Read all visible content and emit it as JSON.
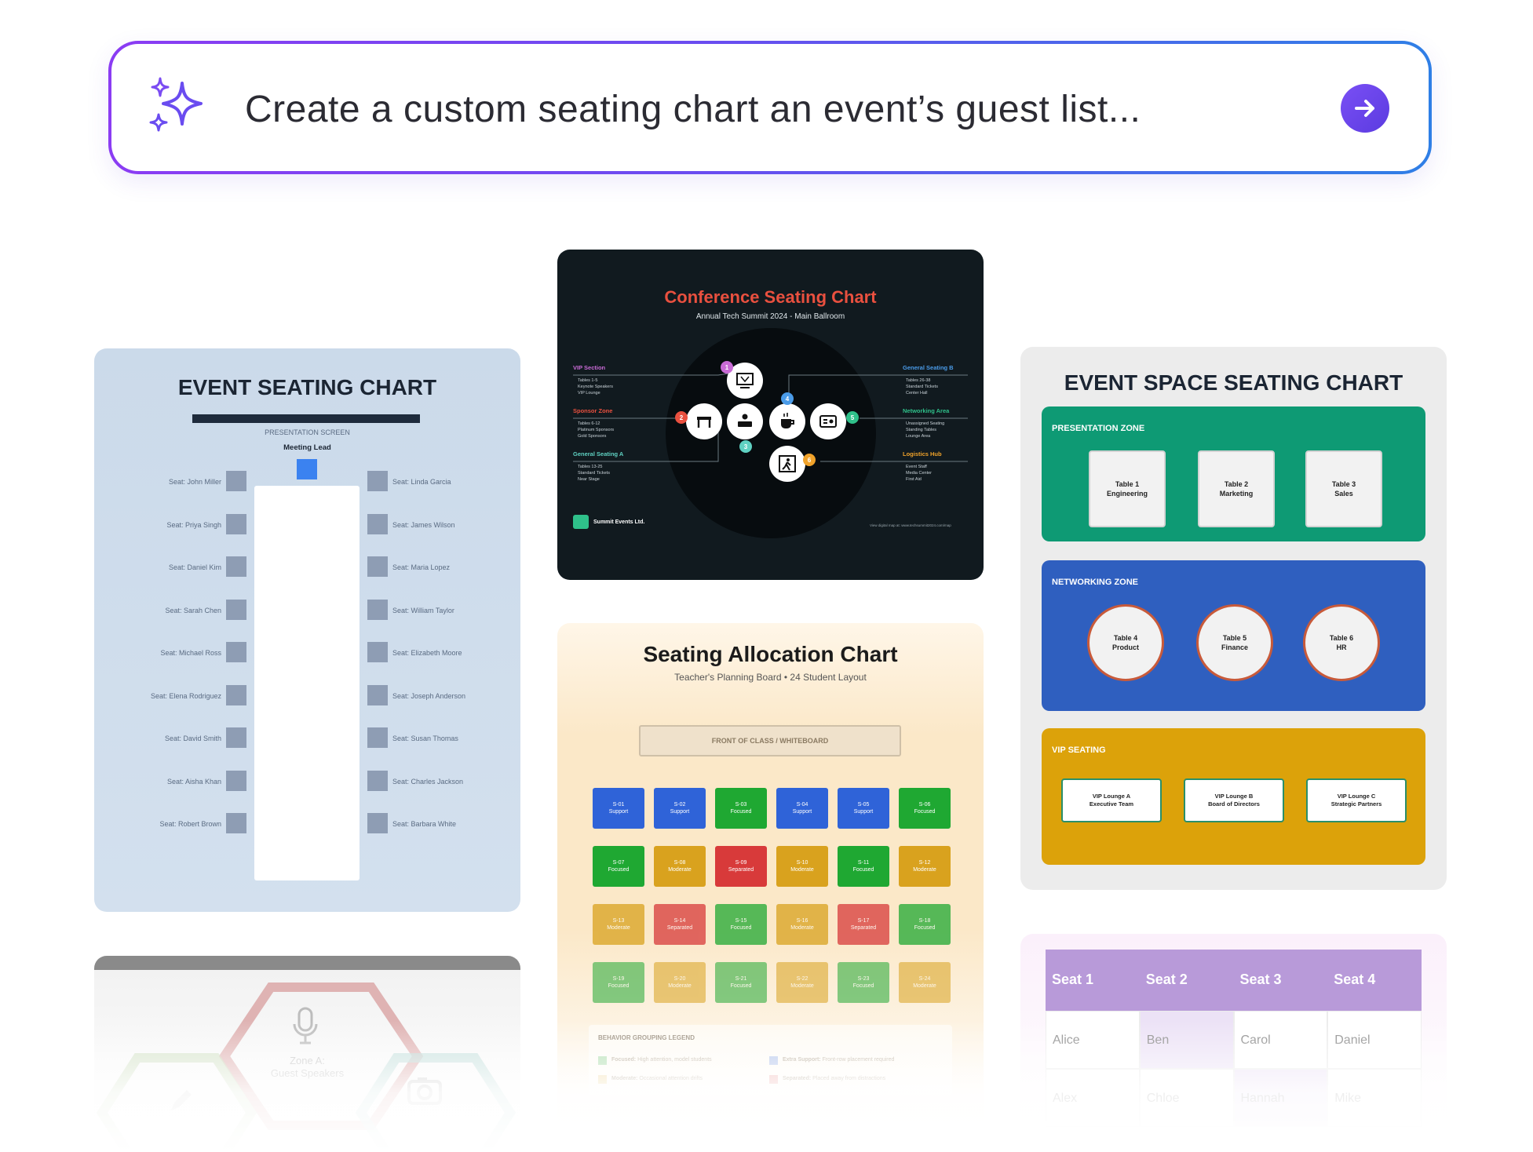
{
  "prompt": {
    "text": "Create a custom seating chart an event’s guest list...",
    "accent_from": "#8b3cf3",
    "accent_to": "#2f7fe6",
    "send_icon": "arrow-right-icon",
    "left_icon": "sparkle-icon"
  },
  "event_chart": {
    "title": "EVENT SEATING CHART",
    "screen_label": "PRESENTATION SCREEN",
    "lead_label": "Meeting Lead",
    "left_seats": [
      "Seat: John Miller",
      "Seat: Priya Singh",
      "Seat: Daniel Kim",
      "Seat: Sarah Chen",
      "Seat: Michael Ross",
      "Seat: Elena Rodriguez",
      "Seat: David Smith",
      "Seat: Aisha Khan",
      "Seat: Robert Brown"
    ],
    "right_seats": [
      "Seat: Linda Garcia",
      "Seat: James Wilson",
      "Seat: Maria Lopez",
      "Seat: William Taylor",
      "Seat: Elizabeth Moore",
      "Seat: Joseph Anderson",
      "Seat: Susan Thomas",
      "Seat: Charles Jackson",
      "Seat: Barbara White"
    ]
  },
  "conference": {
    "title": "Conference Seating Chart",
    "subtitle": "Annual Tech Summit 2024 - Main Ballroom",
    "left_sections": [
      {
        "name": "VIP Section",
        "color": "#c96bd6",
        "bullets": [
          "Tables 1-5",
          "Keynote Speakers",
          "VIP Lounge"
        ]
      },
      {
        "name": "Sponsor Zone",
        "color": "#e9503f",
        "bullets": [
          "Tables 6-12",
          "Platinum Sponsors",
          "Gold Sponsors"
        ]
      },
      {
        "name": "General Seating A",
        "color": "#5fd1c2",
        "bullets": [
          "Tables 13-25",
          "Standard Tickets",
          "Near Stage"
        ]
      }
    ],
    "right_sections": [
      {
        "name": "General Seating B",
        "color": "#4a9be8",
        "bullets": [
          "Tables 26-38",
          "Standard Tickets",
          "Center Hall"
        ]
      },
      {
        "name": "Networking Area",
        "color": "#2fc08a",
        "bullets": [
          "Unassigned Seating",
          "Standing Tables",
          "Lounge Area"
        ]
      },
      {
        "name": "Logistics Hub",
        "color": "#f0a22a",
        "bullets": [
          "Event Staff",
          "Media Center",
          "First Aid"
        ]
      }
    ],
    "numbers": [
      "1",
      "2",
      "3",
      "4",
      "5",
      "6"
    ],
    "brand": "Summit Events Ltd.",
    "footer_link": "View digital map at: www.techsummit2024.com/map"
  },
  "space_chart": {
    "title": "EVENT SPACE SEATING CHART",
    "presentation_zone": {
      "label": "PRESENTATION ZONE",
      "color": "#0e9a74",
      "tables": [
        [
          "Table 1",
          "Engineering"
        ],
        [
          "Table 2",
          "Marketing"
        ],
        [
          "Table 3",
          "Sales"
        ]
      ]
    },
    "networking_zone": {
      "label": "NETWORKING ZONE",
      "color": "#2f5fbf",
      "tables": [
        [
          "Table 4",
          "Product"
        ],
        [
          "Table 5",
          "Finance"
        ],
        [
          "Table 6",
          "HR"
        ]
      ]
    },
    "vip_zone": {
      "label": "VIP SEATING",
      "color": "#dca20a",
      "tables": [
        [
          "VIP Lounge A",
          "Executive Team"
        ],
        [
          "VIP Lounge B",
          "Board of Directors"
        ],
        [
          "VIP Lounge C",
          "Strategic Partners"
        ]
      ]
    }
  },
  "allocation": {
    "title": "Seating Allocation Chart",
    "subtitle": "Teacher's Planning Board • 24 Student Layout",
    "front_label": "FRONT OF CLASS / WHITEBOARD",
    "seats": [
      [
        "S-01",
        "Support"
      ],
      [
        "S-02",
        "Support"
      ],
      [
        "S-03",
        "Focused"
      ],
      [
        "S-04",
        "Support"
      ],
      [
        "S-05",
        "Support"
      ],
      [
        "S-06",
        "Focused"
      ],
      [
        "S-07",
        "Focused"
      ],
      [
        "S-08",
        "Moderate"
      ],
      [
        "S-09",
        "Separated"
      ],
      [
        "S-10",
        "Moderate"
      ],
      [
        "S-11",
        "Focused"
      ],
      [
        "S-12",
        "Moderate"
      ],
      [
        "S-13",
        "Moderate"
      ],
      [
        "S-14",
        "Separated"
      ],
      [
        "S-15",
        "Focused"
      ],
      [
        "S-16",
        "Moderate"
      ],
      [
        "S-17",
        "Separated"
      ],
      [
        "S-18",
        "Focused"
      ],
      [
        "S-19",
        "Focused"
      ],
      [
        "S-20",
        "Moderate"
      ],
      [
        "S-21",
        "Focused"
      ],
      [
        "S-22",
        "Moderate"
      ],
      [
        "S-23",
        "Focused"
      ],
      [
        "S-24",
        "Moderate"
      ]
    ],
    "colors": {
      "Support": "#2f63d8",
      "Focused": "#1fa832",
      "Moderate": "#d9a21e",
      "Separated": "#d83a3a"
    },
    "legend_title": "BEHAVIOR GROUPING LEGEND",
    "legend": [
      {
        "label": "Focused:",
        "desc": "High attention, model students",
        "color": "#1fa832"
      },
      {
        "label": "Extra Support:",
        "desc": "Front-row placement required",
        "color": "#2f63d8"
      },
      {
        "label": "Moderate:",
        "desc": "Occasional attention drifts",
        "color": "#d9a21e"
      },
      {
        "label": "Separated:",
        "desc": "Placed away from distractions",
        "color": "#d83a3a"
      }
    ]
  },
  "zone_card": {
    "zone_label_line1": "Zone A:",
    "zone_label_line2": "Guest Speakers"
  },
  "seat_table": {
    "headers": [
      "Seat 1",
      "Seat 2",
      "Seat 3",
      "Seat 4"
    ],
    "rows": [
      [
        "Alice",
        "Ben",
        "Carol",
        "Daniel"
      ],
      [
        "Alex",
        "Chloe",
        "Hannah",
        "Mike"
      ]
    ],
    "header_color": "#b89ad9"
  }
}
